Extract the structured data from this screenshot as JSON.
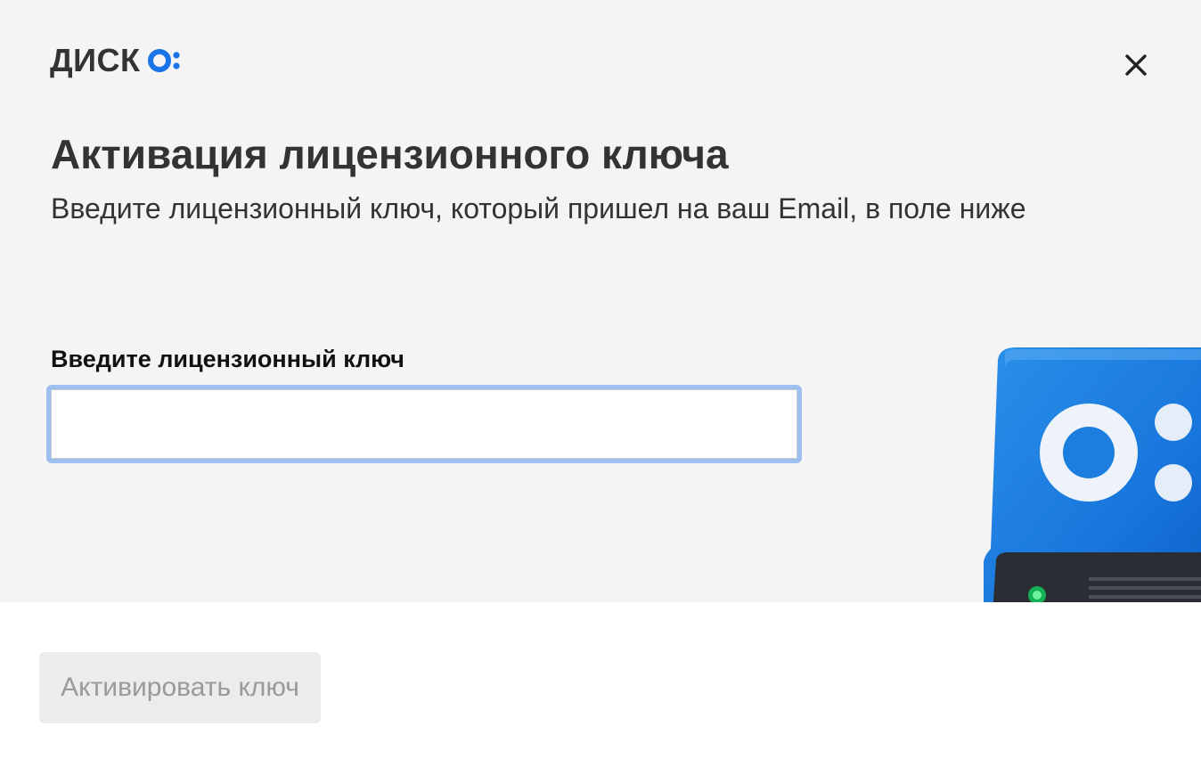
{
  "header": {
    "logo_text": "ДИСК",
    "logo_icon": "disk-o-logo-icon",
    "close_icon": "close-icon"
  },
  "main": {
    "title": "Активация лицензионного ключа",
    "subtitle": "Введите лицензионный ключ, который пришел на ваш Email, в поле ниже",
    "field_label": "Введите лицензионный ключ",
    "key_input_value": "",
    "key_input_placeholder": ""
  },
  "footer": {
    "activate_label": "Активировать ключ"
  },
  "colors": {
    "panel_background": "#f4f4f4",
    "logo_accent": "#1a73e8",
    "input_focus_ring": "#9cbef0",
    "button_disabled_bg": "#ececec",
    "button_disabled_text": "#9a9a9a"
  }
}
